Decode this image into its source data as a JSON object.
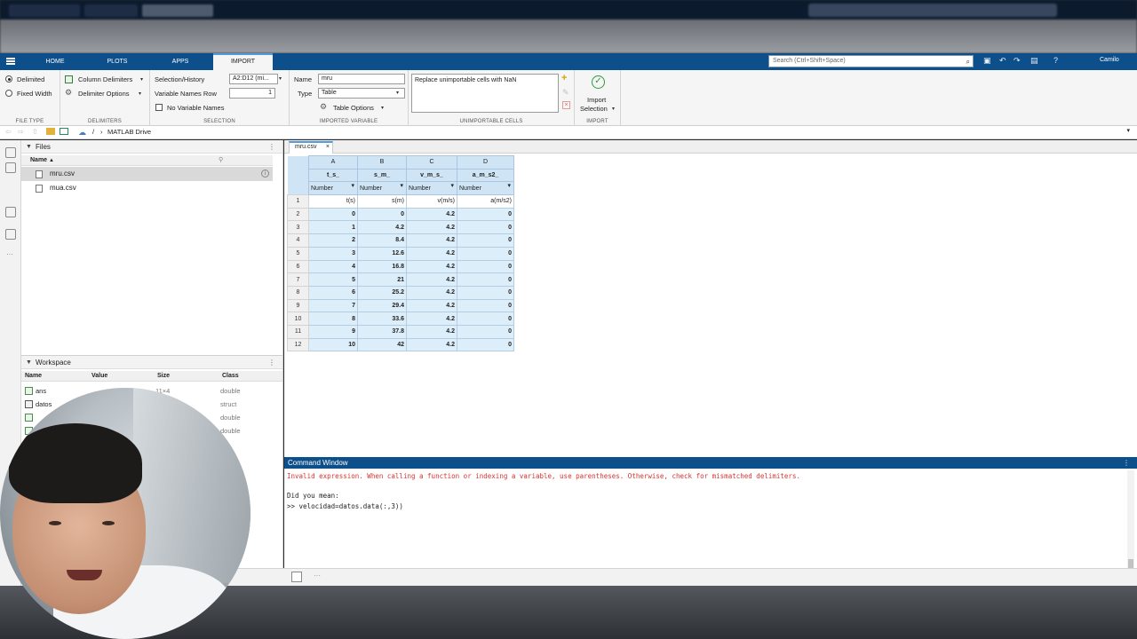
{
  "ribbon_tabs": [
    "HOME",
    "PLOTS",
    "APPS",
    "IMPORT"
  ],
  "search_placeholder": "Search (Ctrl+Shift+Space)",
  "user": "Camilo",
  "file_type": {
    "delimited": "Delimited",
    "fixed_width": "Fixed Width",
    "label": "FILE TYPE"
  },
  "delimiters": {
    "column_delimiters": "Column Delimiters",
    "delimiter_options": "Delimiter Options",
    "label": "DELIMITERS"
  },
  "selection": {
    "history_label": "Selection/History",
    "history_value": "A2:D12 (mi...",
    "varnames_row_label": "Variable Names Row",
    "varnames_row_value": "1",
    "no_var_names": "No Variable Names",
    "label": "SELECTION"
  },
  "imported_variable": {
    "name_label": "Name",
    "name_value": "mru",
    "type_label": "Type",
    "type_value": "Table",
    "table_options": "Table Options",
    "label": "IMPORTED VARIABLE"
  },
  "unimportable": {
    "rule": "Replace unimportable cells with NaN",
    "label": "UNIMPORTABLE CELLS"
  },
  "import": {
    "button_line1": "Import",
    "button_line2": "Selection",
    "label": "IMPORT"
  },
  "address": {
    "root": "/",
    "folder": "MATLAB Drive"
  },
  "files_panel": {
    "title": "Files",
    "col_name": "Name",
    "files": [
      "mru.csv",
      "mua.csv"
    ]
  },
  "workspace_panel": {
    "title": "Workspace",
    "columns": [
      "Name",
      "Value",
      "Size",
      "Class"
    ],
    "rows": [
      {
        "name": "ans",
        "value": "",
        "size": "11×4",
        "class": "double"
      },
      {
        "name": "datos",
        "value": "",
        "size": "",
        "class": "struct"
      },
      {
        "name": "",
        "value": "",
        "size": "",
        "class": "double"
      },
      {
        "name": "",
        "value": "",
        "size": "",
        "class": "double"
      }
    ]
  },
  "document_tab": "mru.csv",
  "sheet": {
    "col_letters": [
      "A",
      "B",
      "C",
      "D"
    ],
    "var_names": [
      "t_s_",
      "s_m_",
      "v_m_s_",
      "a_m_s2_"
    ],
    "types": [
      "Number",
      "Number",
      "Number",
      "Number"
    ],
    "units_row": [
      "t(s)",
      "s(m)",
      "v(m/s)",
      "a(m/s2)"
    ],
    "rows": [
      [
        "0",
        "0",
        "4.2",
        "0"
      ],
      [
        "1",
        "4.2",
        "4.2",
        "0"
      ],
      [
        "2",
        "8.4",
        "4.2",
        "0"
      ],
      [
        "3",
        "12.6",
        "4.2",
        "0"
      ],
      [
        "4",
        "16.8",
        "4.2",
        "0"
      ],
      [
        "5",
        "21",
        "4.2",
        "0"
      ],
      [
        "6",
        "25.2",
        "4.2",
        "0"
      ],
      [
        "7",
        "29.4",
        "4.2",
        "0"
      ],
      [
        "8",
        "33.6",
        "4.2",
        "0"
      ],
      [
        "9",
        "37.8",
        "4.2",
        "0"
      ],
      [
        "10",
        "42",
        "4.2",
        "0"
      ]
    ]
  },
  "command_window": {
    "title": "Command Window",
    "error": "Invalid expression. When calling a function or indexing a variable, use parentheses. Otherwise, check for mismatched delimiters.",
    "did_you_mean": "Did you mean:",
    "suggestion": ">> velocidad=datos.data(:,3))"
  },
  "colors": {
    "ribbon_blue": "#0c4f8a",
    "error_red": "#d9332f",
    "sheet_header": "#cfe4f4",
    "sheet_cell": "#ddeefb"
  }
}
